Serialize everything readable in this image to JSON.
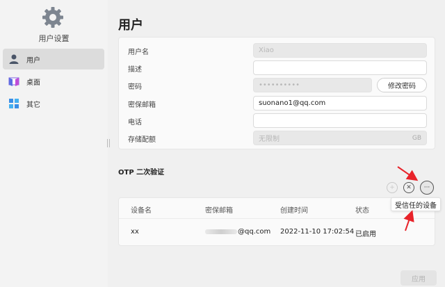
{
  "app": {
    "title": "用户设置"
  },
  "sidebar": {
    "items": [
      {
        "label": "用户",
        "icon": "user-icon",
        "active": true
      },
      {
        "label": "桌面",
        "icon": "desktop-icon",
        "active": false
      },
      {
        "label": "其它",
        "icon": "apps-icon",
        "active": false
      }
    ]
  },
  "page": {
    "title": "用户"
  },
  "form": {
    "username": {
      "label": "用户名",
      "value": "Xiao"
    },
    "description": {
      "label": "描述",
      "value": ""
    },
    "password": {
      "label": "密码",
      "value": "••••••••••",
      "button": "修改密码"
    },
    "email": {
      "label": "密保邮箱",
      "value": "suonano1@qq.com"
    },
    "phone": {
      "label": "电话",
      "value": ""
    },
    "quota": {
      "label": "存储配额",
      "value": "无限制",
      "unit": "GB"
    }
  },
  "otp": {
    "title": "OTP 二次验证",
    "columns": [
      "设备名",
      "密保邮箱",
      "创建时间",
      "状态"
    ],
    "rows": [
      {
        "device": "xx",
        "email": "@qq.com",
        "created": "2022-11-10 17:02:54",
        "status": "已启用"
      }
    ],
    "tooltip": "受信任的设备"
  },
  "footer": {
    "apply": "应用"
  },
  "colors": {
    "annotation": "#e8232a",
    "active_nav": "#dcdcdc"
  }
}
